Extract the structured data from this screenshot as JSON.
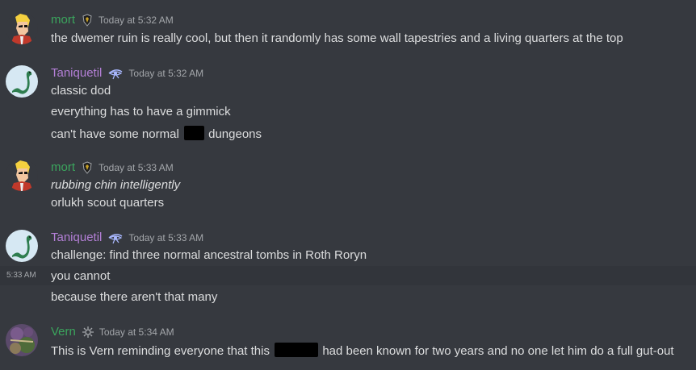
{
  "colors": {
    "background": "#36393f",
    "hover_row": "#32353b",
    "text": "#dcddde",
    "timestamp": "#a3a6aa",
    "mort": "#3ba55d",
    "taniquetil": "#b37fd6",
    "vern": "#3ba55d",
    "spoiler": "#000000"
  },
  "groups": [
    {
      "author": "mort",
      "badge_icon": "shield-badge-icon",
      "timestamp": "Today at 5:32 AM",
      "messages": [
        {
          "text": "the dwemer ruin is really cool, but then it randomly has some wall tapestries and a living quarters at the top"
        }
      ]
    },
    {
      "author": "Taniquetil",
      "badge_icon": "eye-badge-icon",
      "timestamp": "Today at 5:32 AM",
      "messages": [
        {
          "text": "classic dod"
        },
        {
          "text": "everything has to have a gimmick"
        },
        {
          "before": "can't have some normal",
          "after": "dungeons"
        }
      ]
    },
    {
      "author": "mort",
      "badge_icon": "shield-badge-icon",
      "timestamp": "Today at 5:33 AM",
      "messages": [
        {
          "text": "rubbing chin intelligently"
        },
        {
          "text": "orlukh scout quarters"
        }
      ]
    },
    {
      "author": "Taniquetil",
      "badge_icon": "eye-badge-icon",
      "timestamp": "Today at 5:33 AM",
      "hover_timestamp": "5:33 AM",
      "messages": [
        {
          "text": "challenge: find three normal ancestral tombs in Roth Roryn"
        },
        {
          "text": "you cannot"
        },
        {
          "text": "because there aren't that many"
        }
      ]
    },
    {
      "author": "Vern",
      "badge_icon": "gear-badge-icon",
      "timestamp": "Today at 5:34 AM",
      "messages": [
        {
          "before": "This is Vern reminding everyone that this",
          "after": "had been known for two years and no one let him do a full gut-out"
        }
      ]
    }
  ]
}
